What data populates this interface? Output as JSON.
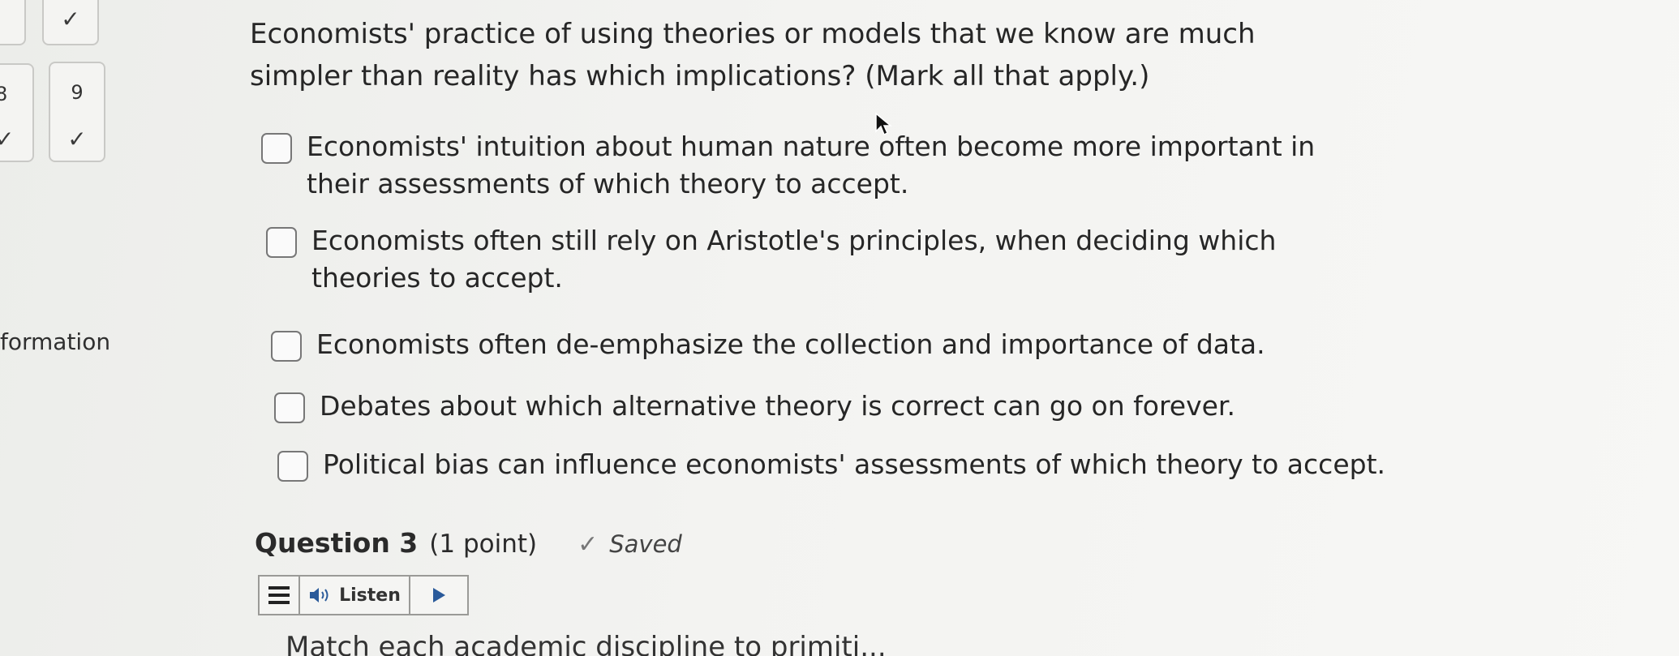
{
  "navigator": {
    "tiles": [
      {
        "number": "",
        "check": "✓"
      },
      {
        "number": "8",
        "check": "✓"
      },
      {
        "number": "9",
        "check": "✓"
      }
    ],
    "side_label": "formation"
  },
  "question": {
    "text": "Economists' practice of using theories or models that we know are much simpler than reality has which implications? (Mark all that apply.)",
    "options": [
      {
        "label": "Economists' intuition about human nature often become more important in their assessments of which theory to accept.",
        "checked": false
      },
      {
        "label": "Economists often still rely on Aristotle's principles, when deciding which theories to accept.",
        "checked": false
      },
      {
        "label": "Economists often de-emphasize the collection and importance of data.",
        "checked": false
      },
      {
        "label": "Debates about which alternative theory is correct can go on forever.",
        "checked": false
      },
      {
        "label": "Political bias can influence economists' assessments of which theory to accept.",
        "checked": false
      }
    ]
  },
  "next_question": {
    "title": "Question 3",
    "points": "(1 point)",
    "status_icon": "check-icon",
    "status": "Saved",
    "listen_label": "Listen",
    "text_preview": "Match each academic discipline to primiti..."
  }
}
